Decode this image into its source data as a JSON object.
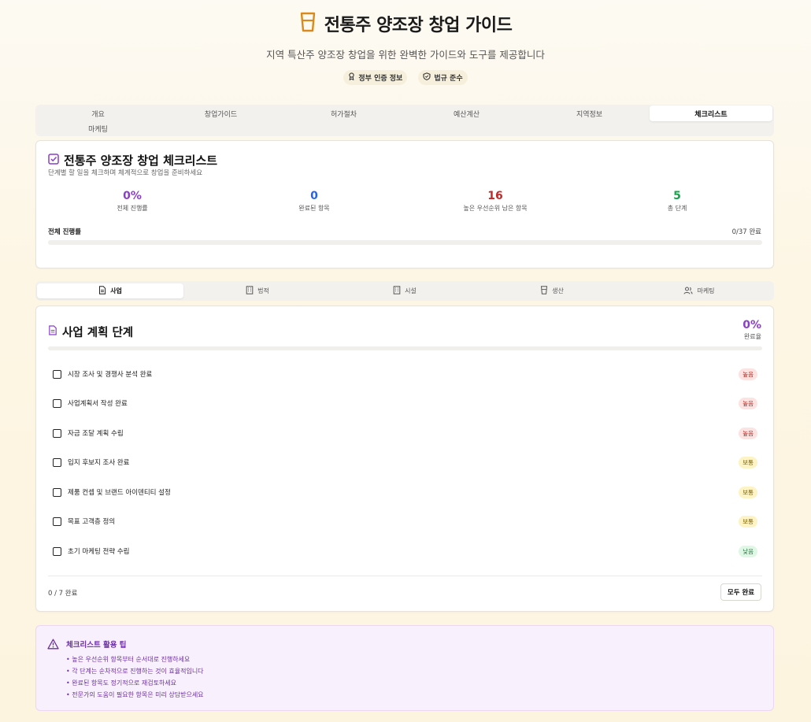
{
  "header": {
    "title": "전통주 양조장 창업 가이드",
    "subtitle": "지역 특산주 양조장 창업을 위한 완벽한 가이드와 도구를 제공합니다",
    "icon": "beer-glass-icon",
    "badges": [
      {
        "label": "정부 인증 정보",
        "icon": "award-icon"
      },
      {
        "label": "법규 준수",
        "icon": "shield-icon"
      }
    ]
  },
  "tabs": [
    "개요",
    "창업가이드",
    "허가절차",
    "예산계산",
    "지역정보",
    "체크리스트",
    "마케팅"
  ],
  "active_tab": "체크리스트",
  "checklist": {
    "title": "전통주 양조장 창업 체크리스트",
    "description": "단계별 할 일을 체크하며 체계적으로 창업을 준비하세요",
    "stats": [
      {
        "value": "0%",
        "label": "전체 진행률",
        "color": "#8b3fc9"
      },
      {
        "value": "0",
        "label": "완료된 항목",
        "color": "#2563eb"
      },
      {
        "value": "16",
        "label": "높은 우선순위 남은 항목",
        "color": "#c62828"
      },
      {
        "value": "5",
        "label": "총 단계",
        "color": "#16a34a"
      }
    ],
    "progress_label": "전체 진행률",
    "progress_count": "0/37 완료",
    "progress_fraction": 0
  },
  "subtabs": [
    {
      "label": "사업",
      "icon": "file-text-icon"
    },
    {
      "label": "법적",
      "icon": "building-icon"
    },
    {
      "label": "시설",
      "icon": "building-icon"
    },
    {
      "label": "생산",
      "icon": "beer-glass-icon"
    },
    {
      "label": "마케팅",
      "icon": "users-icon"
    }
  ],
  "active_subtab": "사업",
  "stage": {
    "title": "사업 계획 단계",
    "percent": "0%",
    "percent_label": "완료율",
    "progress_fraction": 0,
    "items": [
      {
        "label": "시장 조사 및 경쟁사 분석 완료",
        "priority": "높음",
        "level": "high",
        "checked": false
      },
      {
        "label": "사업계획서 작성 완료",
        "priority": "높음",
        "level": "high",
        "checked": false
      },
      {
        "label": "자금 조달 계획 수립",
        "priority": "높음",
        "level": "high",
        "checked": false
      },
      {
        "label": "입지 후보지 조사 완료",
        "priority": "보통",
        "level": "mid",
        "checked": false
      },
      {
        "label": "제품 컨셉 및 브랜드 아이덴티티 설정",
        "priority": "보통",
        "level": "mid",
        "checked": false
      },
      {
        "label": "목표 고객층 정의",
        "priority": "보통",
        "level": "mid",
        "checked": false
      },
      {
        "label": "초기 마케팅 전략 수립",
        "priority": "낮음",
        "level": "low",
        "checked": false
      }
    ],
    "count": "0 / 7 완료",
    "complete_button": "모두 완료"
  },
  "tips": {
    "title": "체크리스트 활용 팁",
    "icon": "warning-triangle-icon",
    "items": [
      "• 높은 우선순위 항목부터 순서대로 진행하세요",
      "• 각 단계는 순차적으로 진행하는 것이 효율적입니다",
      "• 완료된 항목도 정기적으로 재검토하세요",
      "• 전문가의 도움이 필요한 항목은 미리 상담받으세요"
    ]
  },
  "colors": {
    "accent_purple": "#8b3fc9",
    "brand_amber": "#d98a1c",
    "blue": "#2563eb",
    "red": "#c62828",
    "green": "#16a34a"
  }
}
